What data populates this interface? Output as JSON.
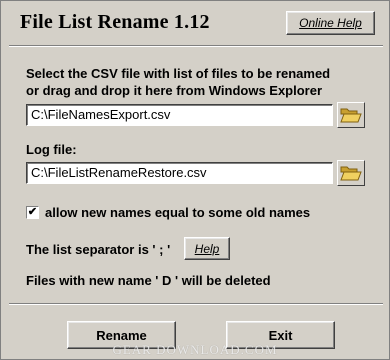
{
  "window": {
    "title": "File List Rename 1.12",
    "online_help_label": "Online Help"
  },
  "main": {
    "instructions": [
      "Select the CSV file with list of files to be renamed",
      "or drag and drop it here from Windows Explorer"
    ],
    "csv_file": {
      "value": "C:\\FileNamesExport.csv"
    },
    "log_file": {
      "label": "Log file:",
      "value": "C:\\FileListRenameRestore.csv"
    },
    "allow_equal_names": {
      "checked": true,
      "check_glyph": "✔",
      "label": "allow new names equal to some old names"
    },
    "separator_text": "The list separator is ' ; '",
    "help_label": "Help",
    "delete_text": "Files with new name ' D ' will be deleted"
  },
  "footer": {
    "rename_label": "Rename",
    "exit_label": "Exit"
  },
  "watermark": "GEAR DOWNLOAD.COM",
  "icons": {
    "browse": "folder-open-icon"
  },
  "colors": {
    "face": "#d4d0c8",
    "folder": "#f0d060"
  }
}
